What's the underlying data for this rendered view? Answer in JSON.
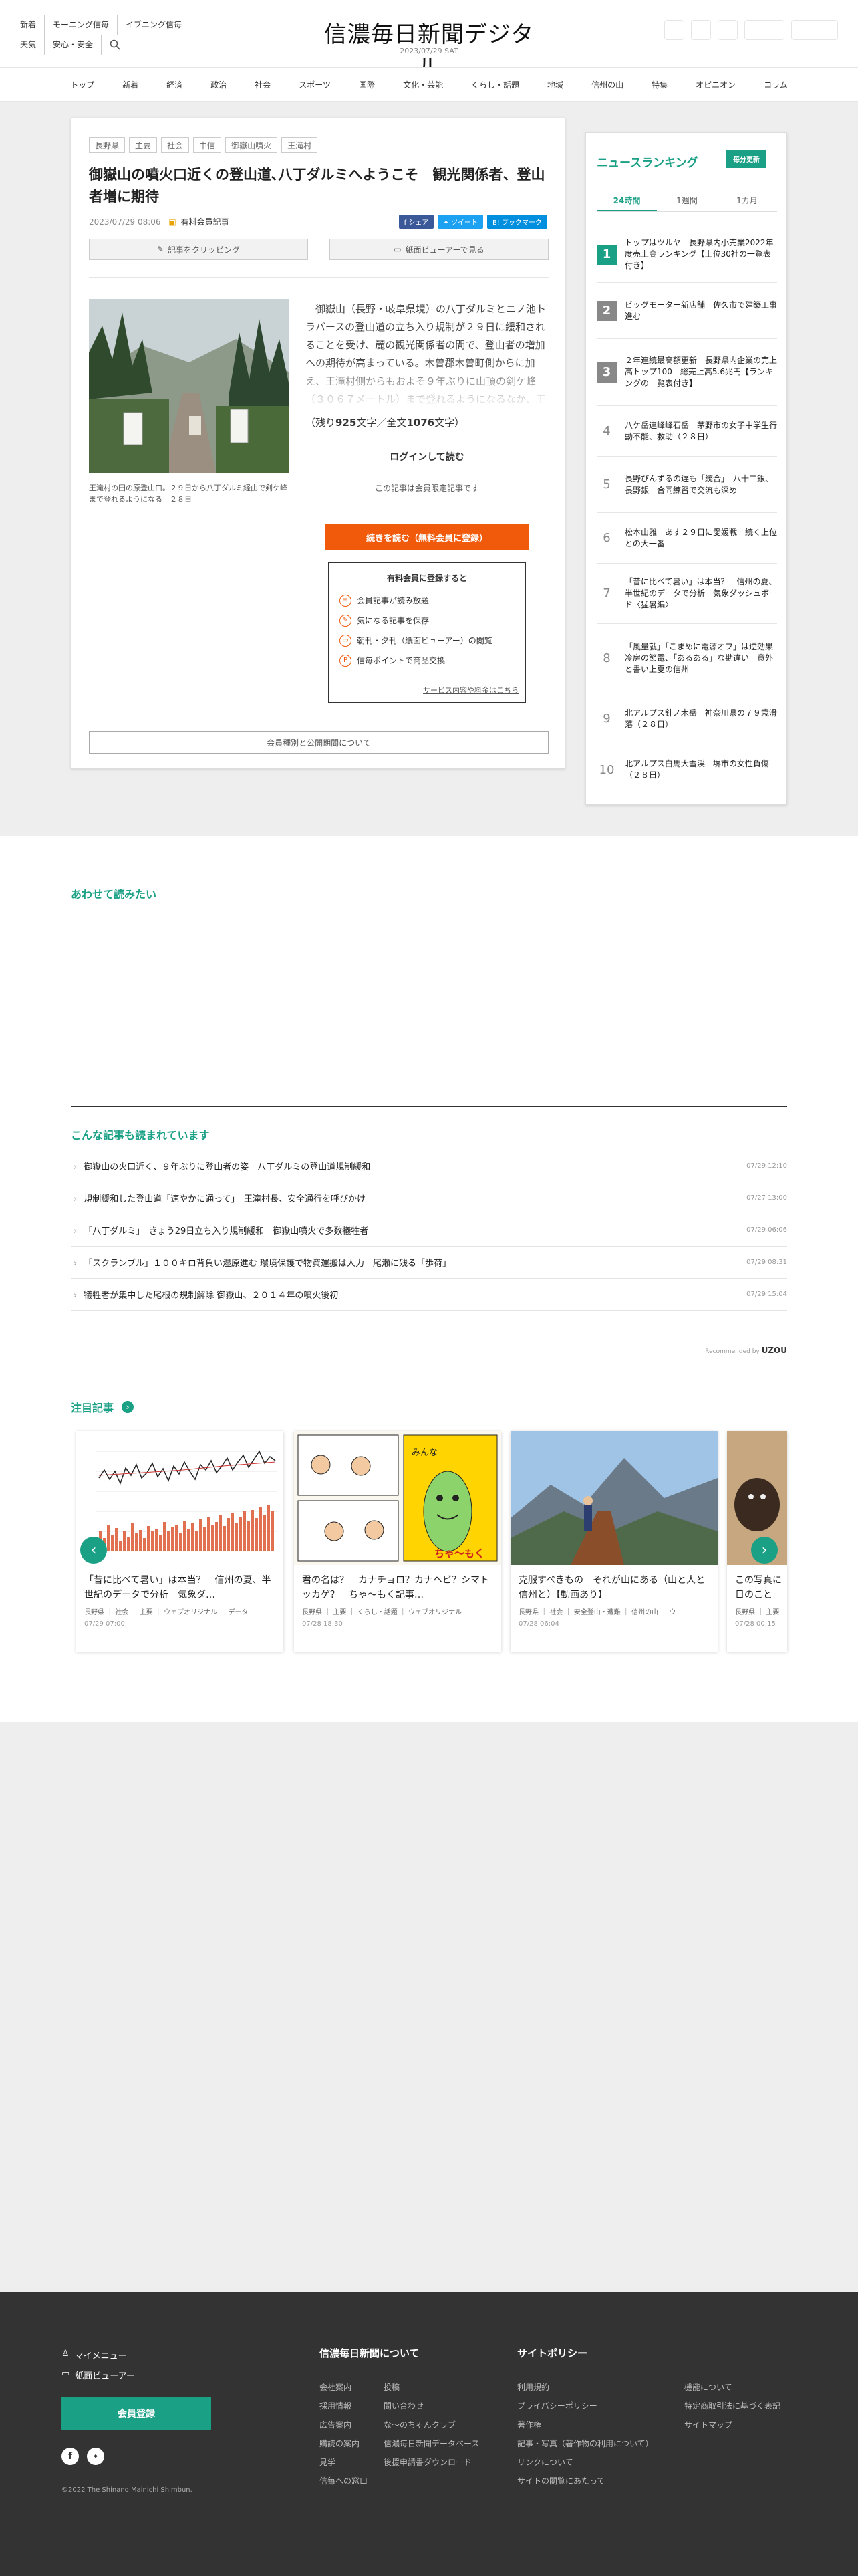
{
  "header": {
    "links_row1": [
      "新着",
      "モーニング信毎",
      "イブニング信毎"
    ],
    "links_row2": [
      "天気",
      "安心・安全"
    ],
    "logo": "信濃毎日新聞デジタル",
    "date": "2023/07/29 SAT"
  },
  "nav": [
    "トップ",
    "新着",
    "経済",
    "政治",
    "社会",
    "スポーツ",
    "国際",
    "文化・芸能",
    "くらし・話題",
    "地域",
    "信州の山",
    "特集",
    "オピニオン",
    "コラム"
  ],
  "article": {
    "tags": [
      "長野県",
      "主要",
      "社会",
      "中信",
      "御嶽山噴火",
      "王滝村"
    ],
    "title": "御嶽山の噴火口近くの登山道､八丁ダルミへようこそ　観光関係者、登山者増に期待",
    "date": "2023/07/29 08:06",
    "member_label": "有料会員記事",
    "share": {
      "facebook": "シェア",
      "twitter": "ツイート",
      "hatena": "ブックマーク"
    },
    "clip_button": "記事をクリッピング",
    "viewer_button": "紙面ビューアーで見る",
    "photo_caption": "王滝村の田の原登山口。２９日から八丁ダルミ経由で剣ケ峰まで登れるようになる＝２８日",
    "body": "　御嶽山（長野・岐阜県境）の八丁ダルミとニノ池トラバースの登山道の立ち入り規制が２９日に緩和されることを受け、麓の観光関係者の間で、登山者の増加への期待が高まっている。木曽郡木曽町側からに加え、王滝村側からもおよそ９年ぶりに山頂の剣ケ峰（３０６７メートル）まで登れるようになるなか、王滝村はふるさと納税",
    "remaining_prefix": "（残り",
    "remaining_chars": "925",
    "remaining_mid": "文字／全文",
    "total_chars": "1076",
    "remaining_suffix": "文字）",
    "login_link": "ログインして読む",
    "limited_note": "この記事は会員限定記事です",
    "cta": "続きを読む（無料会員に登録）",
    "benefits_title": "有料会員に登録すると",
    "benefits": [
      "会員記事が読み放題",
      "気になる記事を保存",
      "朝刊・夕刊（紙面ビューアー）の閲覧",
      "信毎ポイントで商品交換"
    ],
    "service_link": "サービス内容や料金はこちら",
    "terms_button": "会員種別と公開期間について"
  },
  "ranking": {
    "title": "ニュースランキング",
    "badge": "毎分更新",
    "tabs": [
      "24時間",
      "1週間",
      "1カ月"
    ],
    "items": [
      {
        "rank": "1",
        "title": "トップはツルヤ　長野県内小売業2022年度売上高ランキング【上位30社の一覧表付き】"
      },
      {
        "rank": "2",
        "title": "ビッグモーター新店舗　佐久市で建築工事進む"
      },
      {
        "rank": "3",
        "title": "２年連続最高額更新　長野県内企業の売上高トップ100　総売上高5.6兆円【ランキングの一覧表付き】"
      },
      {
        "rank": "4",
        "title": "八ケ岳連峰峰石岳　茅野市の女子中学生行動不能、救助（２８日）"
      },
      {
        "rank": "5",
        "title": "長野びんずるの遅も「統合」　八十二銀、長野銀　合同練習で交流も深め"
      },
      {
        "rank": "6",
        "title": "松本山雅　あす２９日に愛媛戦　続く上位との大一番"
      },
      {
        "rank": "7",
        "title": "「昔に比べて暑い」は本当？　信州の夏、半世紀のデータで分析　気象ダッシュボード〈猛暑編〉"
      },
      {
        "rank": "8",
        "title": "「風量就」「こまめに電源オフ」は逆効果　冷房の節電、「あるある」な勘違い　意外と書い上夏の信州"
      },
      {
        "rank": "9",
        "title": "北アルプス針ノ木岳　神奈川県の７９歳滑落（２８日）"
      },
      {
        "rank": "10",
        "title": "北アルプス白馬大雪渓　堺市の女性負傷（２８日）"
      }
    ]
  },
  "also_read": {
    "title": "あわせて読みたい"
  },
  "popular": {
    "title": "こんな記事も読まれています",
    "items": [
      {
        "title": "御嶽山の火口近く、９年ぶりに登山者の姿　八丁ダルミの登山道規制緩和",
        "date": "07/29 12:10"
      },
      {
        "title": "規制緩和した登山道「速やかに通って」　王滝村長、安全通行を呼びかけ",
        "date": "07/27 13:00"
      },
      {
        "title": "「八丁ダルミ」　きょう29日立ち入り規制緩和　御嶽山噴火で多数犠牲者",
        "date": "07/29 06:06"
      },
      {
        "title": "「スクランブル」１００キロ背負い湿原進む 環境保護で物資運搬は人力　尾瀬に残る「歩荷」",
        "date": "07/29 08:31"
      },
      {
        "title": "犠牲者が集中した尾根の規制解除 御嶽山、２０１４年の噴火後初",
        "date": "07/29 15:04"
      }
    ],
    "recommended_by": "Recommended by"
  },
  "featured": {
    "title": "注目記事",
    "cards": [
      {
        "title": "「昔に比べて暑い」は本当？　信州の夏、半世紀のデータで分析　気象ダ…",
        "cats": "長野県 ｜ 社会 ｜ 主要 ｜ ウェブオリジナル ｜ データ",
        "date": "07/29 07:00"
      },
      {
        "title": "君の名は？　カナチョロ？カナヘビ？シマトッカゲ？　ちゃ〜もく記事…",
        "cats": "長野県 ｜ 主要 ｜ くらし・話題 ｜ ウェブオリジナル",
        "date": "07/28 18:30"
      },
      {
        "title": "克服すべきもの　それが山にある（山と人と信州と）【動画あり】",
        "cats": "長野県 ｜ 社会 ｜ 安全登山・遭難 ｜ 信州の山 ｜ ウ",
        "date": "07/28 06:04"
      },
      {
        "title": "この写真に日のこと",
        "cats": "長野県 ｜ 主要",
        "date": "07/28 00:15"
      }
    ],
    "comic_label1": "みんな",
    "comic_label2": "ちゃ〜もく"
  },
  "footer": {
    "mypage": "マイメニュー",
    "viewer": "紙面ビューアー",
    "register": "会員登録",
    "copyright": "©2022 The Shinano Mainichi Shimbun.",
    "about_title": "信濃毎日新聞について",
    "about_col1": [
      "会社案内",
      "採用情報",
      "広告案内",
      "購読の案内",
      "見学",
      "信毎への窓口"
    ],
    "about_col2": [
      "投稿",
      "問い合わせ",
      "な〜のちゃんクラブ",
      "信濃毎日新聞データベース",
      "後援申請書ダウンロード"
    ],
    "policy_title": "サイトポリシー",
    "policy_col1": [
      "利用規約",
      "プライバシーポリシー",
      "著作権",
      "記事・写真（著作物の利用について）",
      "リンクについて",
      "サイトの閲覧にあたって"
    ],
    "policy_col2": [
      "機能について",
      "特定商取引法に基づく表記",
      "サイトマップ"
    ]
  },
  "colors": {
    "accent": "#1aa085",
    "cta": "#f05a0a",
    "footer": "#333333"
  }
}
